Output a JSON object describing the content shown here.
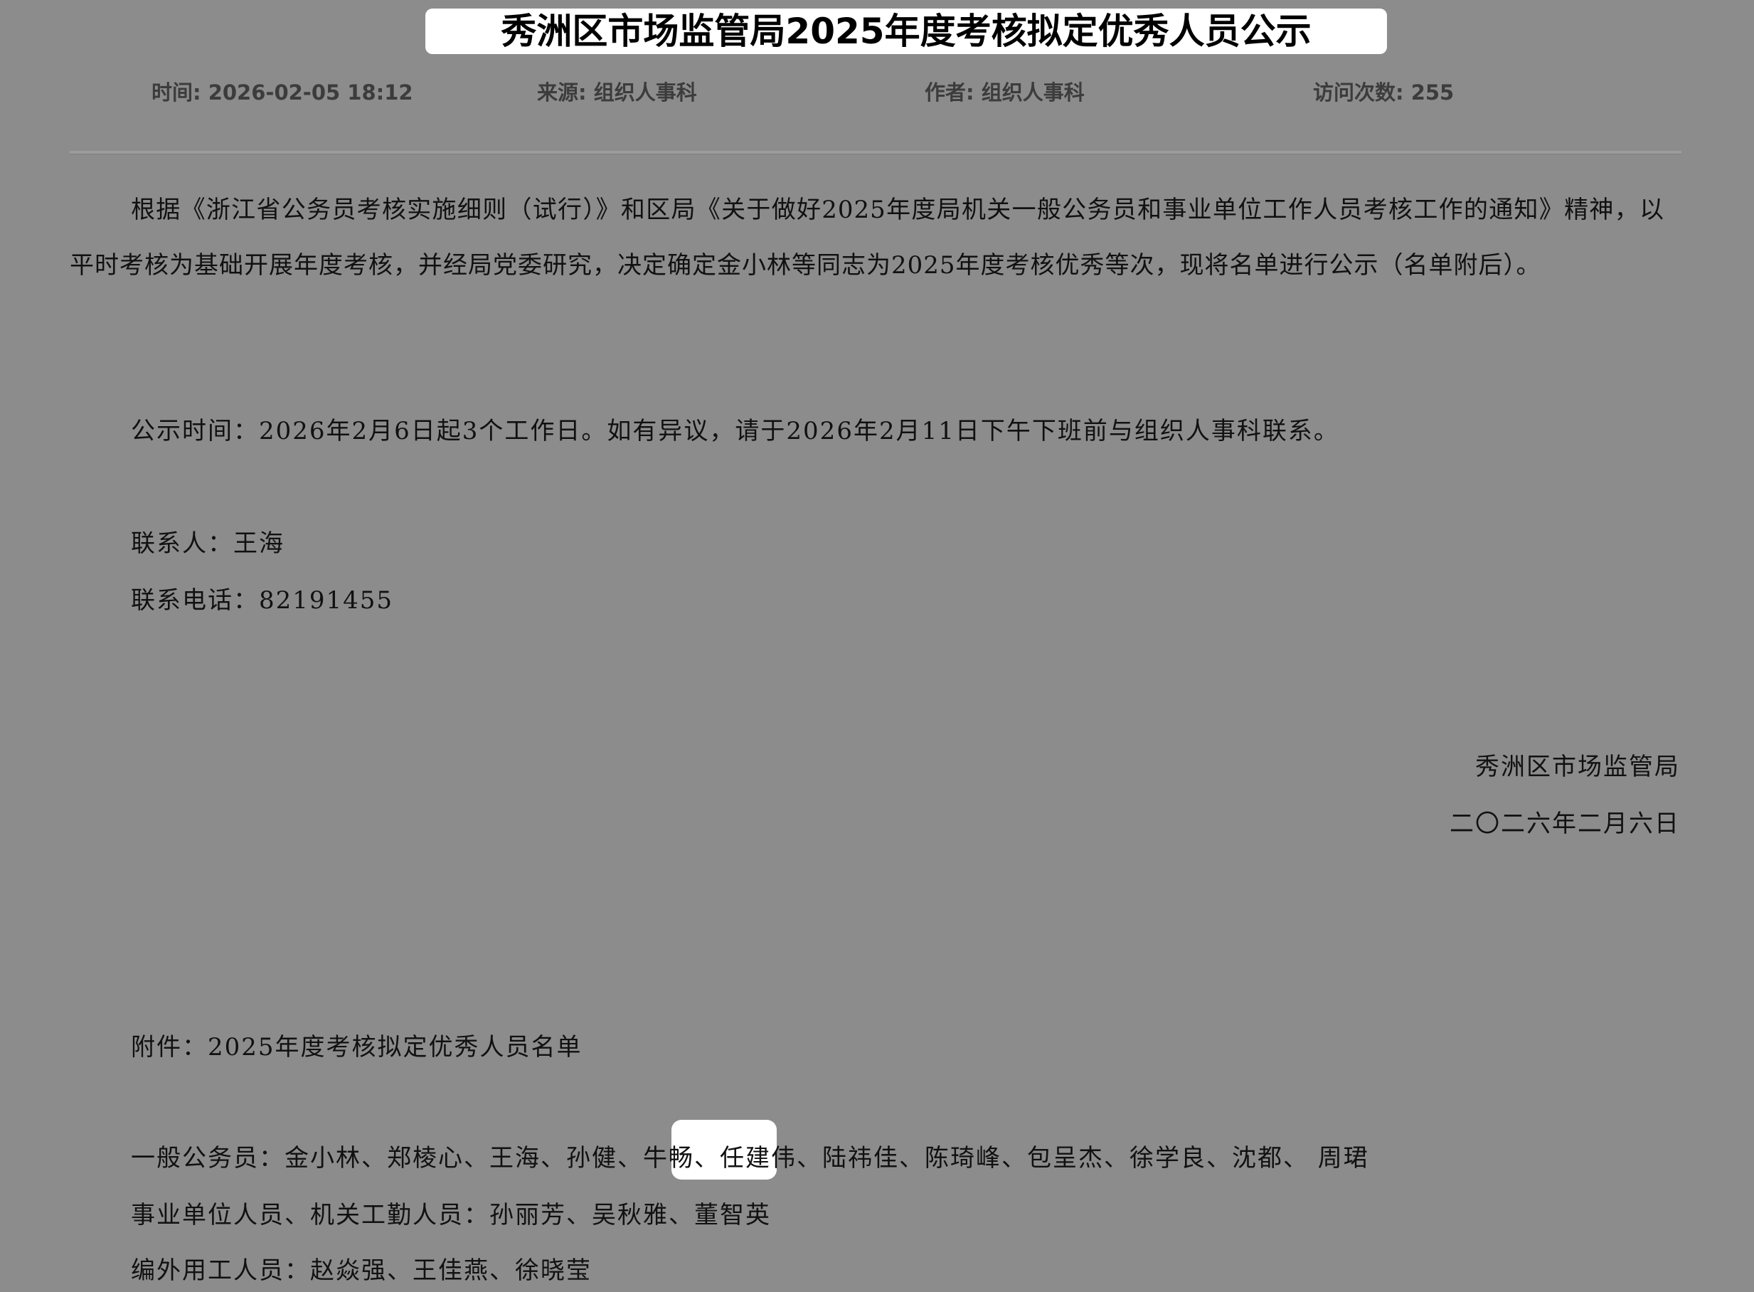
{
  "title": "秀洲区市场监管局2025年度考核拟定优秀人员公示",
  "meta": {
    "time": "时间: 2026-02-05 18:12",
    "source": "来源: 组织人事科",
    "author": "作者: 组织人事科",
    "visits": "访问次数: 255"
  },
  "body": {
    "intro": "根据《浙江省公务员考核实施细则（试行）》和区局《关于做好2025年度局机关一般公务员和事业单位工作人员考核工作的通知》精神，以平时考核为基础开展年度考核，并经局党委研究，决定确定金小林等同志为2025年度考核优秀等次，现将名单进行公示（名单附后）。",
    "publicity_time": "公示时间：2026年2月6日起3个工作日。如有异议，请于2026年2月11日下午下班前与组织人事科联系。",
    "contact": "联系人：王海",
    "phone": "联系电话：82191455",
    "signature_org": "秀洲区市场监管局",
    "signature_date": "二〇二六年二月六日",
    "attachment": "附件：2025年度考核拟定优秀人员名单",
    "civil_servants": "一般公务员：金小林、郑棱心、王海、孙健、牛畅、任建伟、陆祎佳、陈琦峰、包呈杰、徐学良、沈都、 周珺",
    "institution_staff": "事业单位人员、机关工勤人员：孙丽芳、吴秋雅、董智英",
    "extra_staff": "编外用工人员：赵焱强、王佳燕、徐晓莹"
  }
}
